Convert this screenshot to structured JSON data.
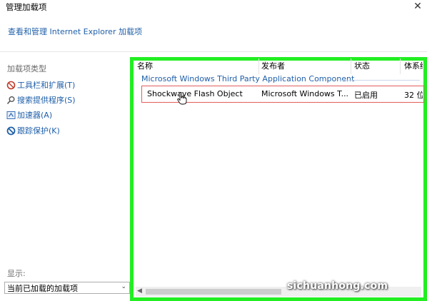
{
  "window": {
    "title": "管理加载项",
    "close_symbol": "✕"
  },
  "header": {
    "link_text": "查看和管理 Internet Explorer 加载项"
  },
  "sidebar": {
    "section_title": "加载项类型",
    "items": [
      {
        "label": "工具栏和扩展(T)",
        "icon": "toolbar-icon"
      },
      {
        "label": "搜索提供程序(S)",
        "icon": "search-icon"
      },
      {
        "label": "加速器(A)",
        "icon": "accelerator-icon"
      },
      {
        "label": "跟踪保护(K)",
        "icon": "block-icon"
      }
    ],
    "show_label": "显示:",
    "show_value": "当前已加载的加载项"
  },
  "table": {
    "columns": [
      "名称",
      "发布者",
      "状态",
      "体系结"
    ],
    "group": "Microsoft Windows Third Party Application Component",
    "rows": [
      {
        "name": "Shockwave Flash Object",
        "publisher": "Microsoft Windows T...",
        "status": "已启用",
        "arch": "32 位"
      }
    ]
  },
  "watermark": "sichuanhong.com",
  "colors": {
    "highlight_border": "#22ee22",
    "row_border": "#e35c5c",
    "link": "#1f5fa8"
  }
}
